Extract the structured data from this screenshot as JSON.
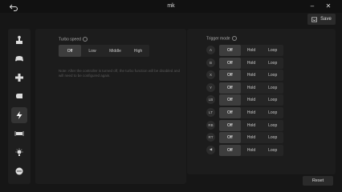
{
  "window": {
    "title": "mk",
    "back_icon": "back-arrow-icon"
  },
  "toolbar": {
    "save_label": "Save",
    "save_icon": "save-icon"
  },
  "sidebar": {
    "items": [
      {
        "icon": "joystick-icon",
        "active": false
      },
      {
        "icon": "controller-icon",
        "active": false
      },
      {
        "icon": "dpad-icon",
        "active": false
      },
      {
        "icon": "trigger-icon",
        "active": false
      },
      {
        "icon": "lightning-icon",
        "active": true
      },
      {
        "icon": "vibration-icon",
        "active": false
      },
      {
        "icon": "light-icon",
        "active": false
      },
      {
        "icon": "more-icon",
        "active": false
      }
    ]
  },
  "turbo": {
    "label": "Turbo speed",
    "options": [
      "Off",
      "Low",
      "Middle",
      "High"
    ],
    "selected": "Off",
    "note": "Note: After the controller is turned off, the turbo function will be disabled and will need to be configured again."
  },
  "trigger": {
    "label": "Trigger mode",
    "options": [
      "Off",
      "Hold",
      "Loop"
    ],
    "rows": [
      {
        "key": "A",
        "selected": "Off"
      },
      {
        "key": "B",
        "selected": "Off"
      },
      {
        "key": "X",
        "selected": "Off"
      },
      {
        "key": "Y",
        "selected": "Off"
      },
      {
        "key": "LB",
        "selected": "Off"
      },
      {
        "key": "LT",
        "selected": "Off"
      },
      {
        "key": "RB",
        "selected": "Off"
      },
      {
        "key": "RT",
        "selected": "Off"
      },
      {
        "key": "◀",
        "selected": "Off"
      }
    ]
  },
  "footer": {
    "reset_label": "Reset"
  },
  "colors": {
    "bg": "#161616",
    "panel": "#1c1c1c",
    "selected": "#3d3d3d"
  }
}
